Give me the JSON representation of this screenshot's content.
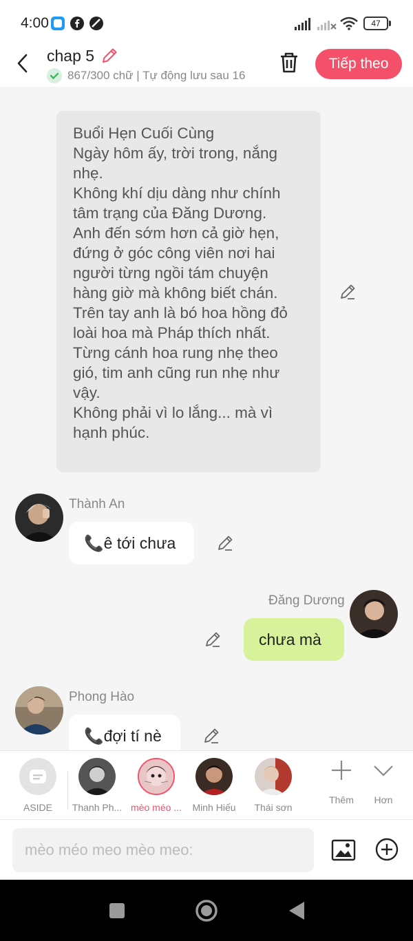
{
  "status_bar": {
    "time": "4:00",
    "battery": "47"
  },
  "header": {
    "title": "chap 5",
    "save_status": "867/300 chữ | Tự động lưu sau 16",
    "next_label": "Tiếp theo",
    "accent_color": "#f4506a"
  },
  "chat": {
    "narration": "Buổi Hẹn Cuối Cùng\nNgày hôm ấy, trời trong, nắng\nnhẹ.\nKhông khí dịu dàng như chính\ntâm trạng của Đăng Dương.\nAnh đến sớm hơn cả giờ hẹn,\nđứng ở góc công viên nơi hai\nngười từng ngồi tám chuyện\nhàng giờ mà không biết chán.\nTrên tay anh là bó hoa hồng đỏ\nloài hoa mà Pháp thích nhất.\nTừng cánh hoa rung nhẹ theo\ngió, tim anh cũng run nhẹ như\nvậy.\nKhông phải vì lo lắng... mà vì\nhạnh phúc.",
    "messages": [
      {
        "sender": "Thành An",
        "text": "📞ê tới chưa",
        "side": "left"
      },
      {
        "sender": "Đăng Dương",
        "text": "chưa mà",
        "side": "right"
      },
      {
        "sender": "Phong Hào",
        "text": "📞đợi tí nè",
        "side": "left"
      }
    ]
  },
  "characters": [
    {
      "label": "ASIDE"
    },
    {
      "label": "Thanh Ph..."
    },
    {
      "label": "mèo méo ...",
      "selected": true
    },
    {
      "label": "Minh Hiếu"
    },
    {
      "label": "Thái sơn"
    }
  ],
  "tools": {
    "more_label": "Thêm",
    "collapse_label": "Hơn"
  },
  "input": {
    "placeholder": "mèo méo meo mèo meo:"
  }
}
